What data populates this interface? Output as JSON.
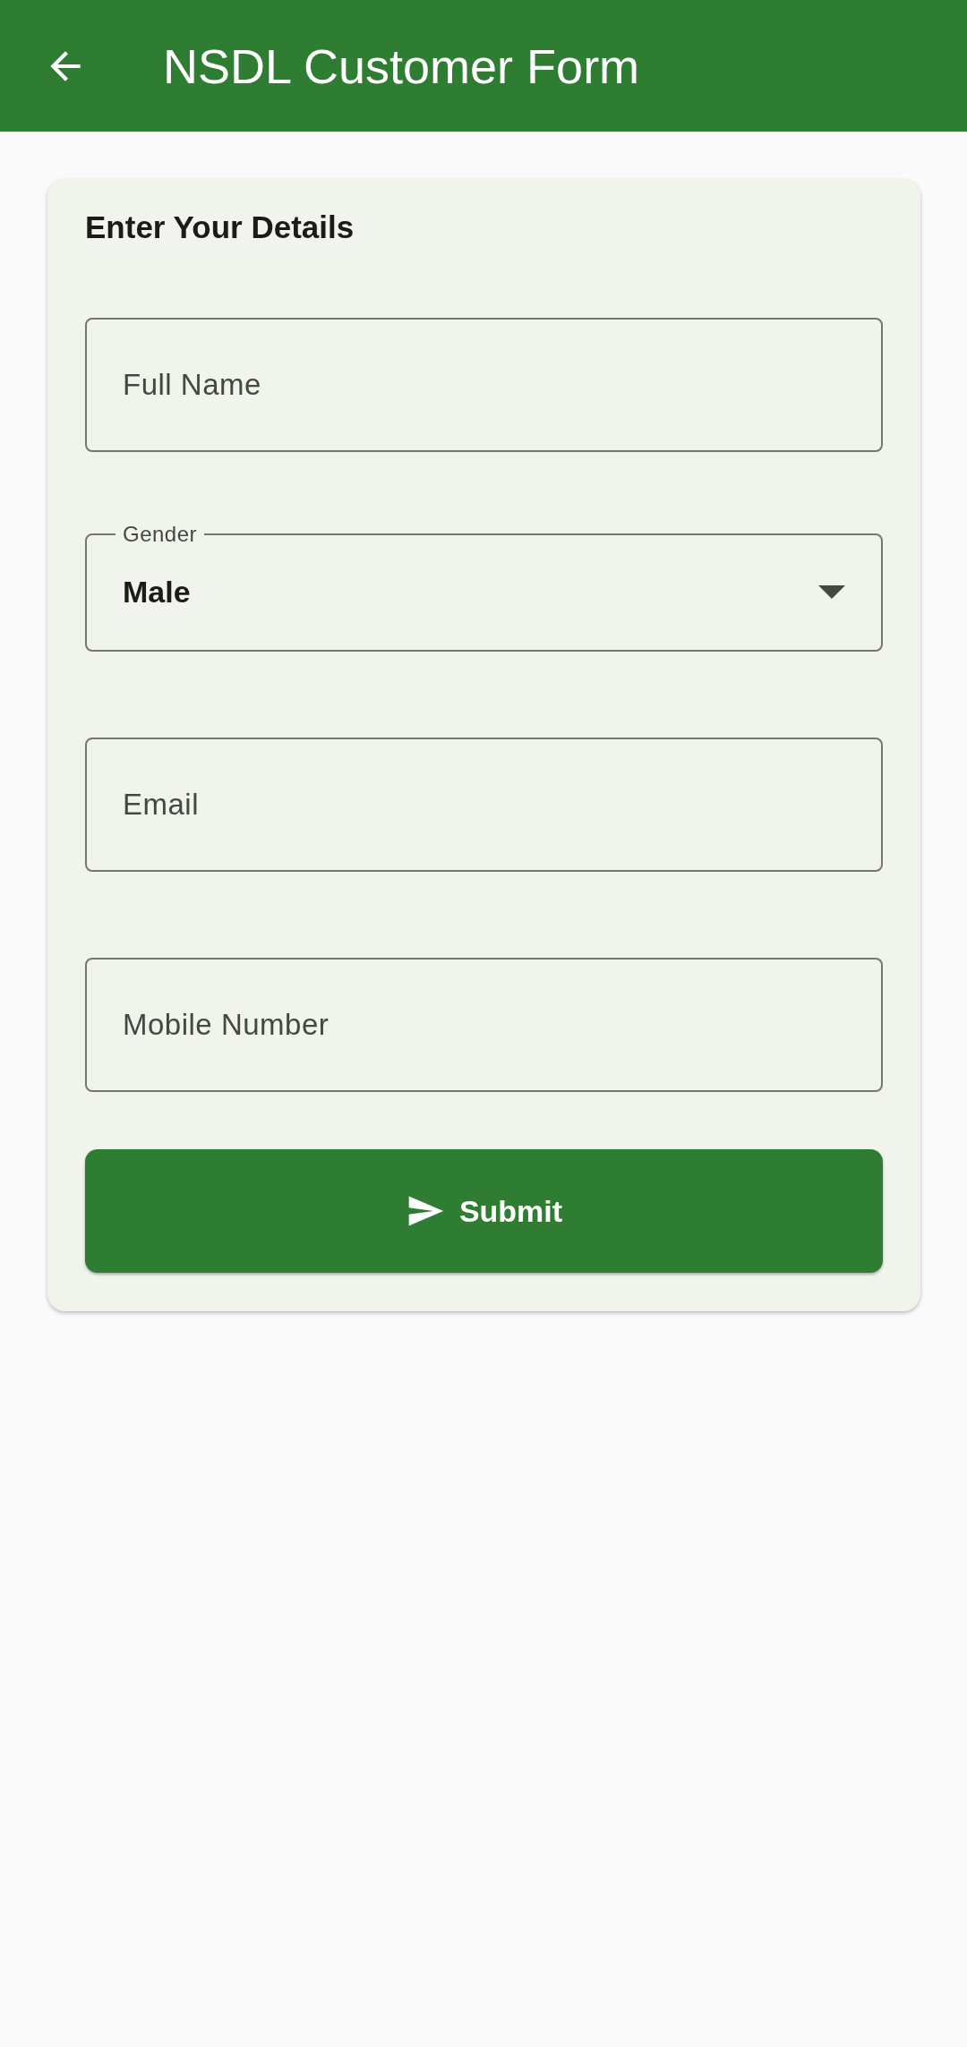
{
  "app_bar": {
    "title": "NSDL Customer Form"
  },
  "form": {
    "heading": "Enter Your Details",
    "fields": [
      {
        "kind": "text",
        "placeholder": "Full Name"
      },
      {
        "kind": "dropdown",
        "label": "Gender",
        "value": "Male"
      },
      {
        "kind": "text",
        "placeholder": "Email"
      },
      {
        "kind": "text",
        "placeholder": "Mobile Number"
      }
    ],
    "submit_button": {
      "label": "Submit"
    }
  }
}
